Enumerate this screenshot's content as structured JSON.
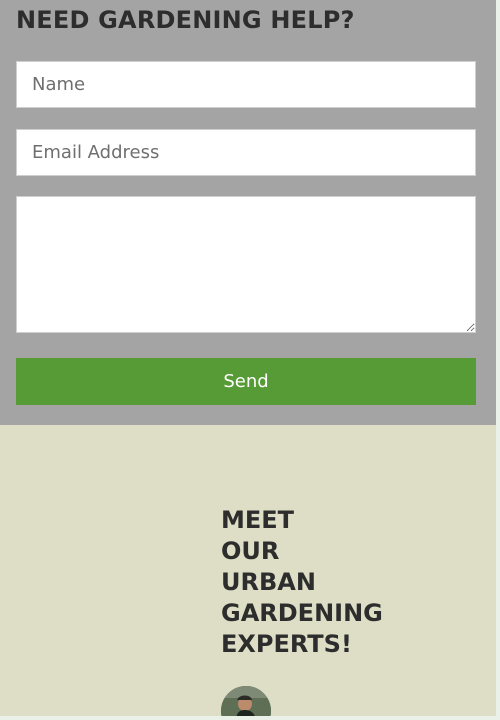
{
  "contact_form": {
    "title": "NEED GARDENING HELP?",
    "name": {
      "placeholder": "Name",
      "value": ""
    },
    "email": {
      "placeholder": "Email Address",
      "value": ""
    },
    "message": {
      "placeholder": "",
      "value": ""
    },
    "send_label": "Send"
  },
  "experts": {
    "title_lines": [
      "MEET",
      "OUR",
      "URBAN",
      "GARDENING",
      "EXPERTS!"
    ]
  },
  "colors": {
    "form_background": "#a4a4a4",
    "send_button": "#579b36",
    "experts_background": "#dedec6",
    "heading_text": "#2d2d2d"
  }
}
